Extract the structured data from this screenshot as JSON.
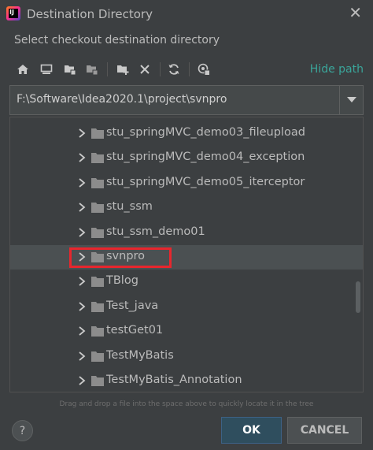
{
  "window": {
    "title": "Destination Directory",
    "subtitle": "Select checkout destination directory"
  },
  "toolbar": {
    "icons": [
      "home-icon",
      "desktop-icon",
      "project-folder-icon",
      "module-folder-icon",
      "new-folder-icon",
      "delete-icon",
      "refresh-icon",
      "show-hidden-icon"
    ],
    "hide_path_label": "Hide path"
  },
  "path": {
    "value": "F:\\Software\\Idea2020.1\\project\\svnpro"
  },
  "tree": {
    "items": [
      {
        "label": "stu_springMVC_demo03_fileupload"
      },
      {
        "label": "stu_springMVC_demo04_exception"
      },
      {
        "label": "stu_springMVC_demo05_iterceptor"
      },
      {
        "label": "stu_ssm"
      },
      {
        "label": "stu_ssm_demo01"
      },
      {
        "label": "svnpro",
        "selected": true
      },
      {
        "label": "TBlog"
      },
      {
        "label": "Test_java"
      },
      {
        "label": "testGet01"
      },
      {
        "label": "TestMyBatis"
      },
      {
        "label": "TestMyBatis_Annotation"
      }
    ]
  },
  "hint": "Drag and drop a file into the space above to quickly locate it in the tree",
  "buttons": {
    "help": "?",
    "ok": "OK",
    "cancel": "CANCEL"
  },
  "colors": {
    "background": "#3c3f41",
    "selection": "#4b5052",
    "accent_link": "#3aa59a",
    "highlight_box": "#e8262d"
  }
}
